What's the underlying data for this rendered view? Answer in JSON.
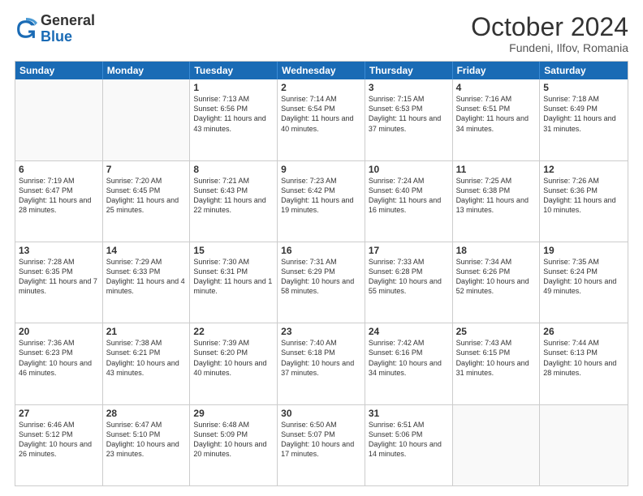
{
  "header": {
    "logo_general": "General",
    "logo_blue": "Blue",
    "month_year": "October 2024",
    "location": "Fundeni, Ilfov, Romania"
  },
  "weekdays": [
    "Sunday",
    "Monday",
    "Tuesday",
    "Wednesday",
    "Thursday",
    "Friday",
    "Saturday"
  ],
  "rows": [
    [
      {
        "day": "",
        "info": ""
      },
      {
        "day": "",
        "info": ""
      },
      {
        "day": "1",
        "info": "Sunrise: 7:13 AM\nSunset: 6:56 PM\nDaylight: 11 hours and 43 minutes."
      },
      {
        "day": "2",
        "info": "Sunrise: 7:14 AM\nSunset: 6:54 PM\nDaylight: 11 hours and 40 minutes."
      },
      {
        "day": "3",
        "info": "Sunrise: 7:15 AM\nSunset: 6:53 PM\nDaylight: 11 hours and 37 minutes."
      },
      {
        "day": "4",
        "info": "Sunrise: 7:16 AM\nSunset: 6:51 PM\nDaylight: 11 hours and 34 minutes."
      },
      {
        "day": "5",
        "info": "Sunrise: 7:18 AM\nSunset: 6:49 PM\nDaylight: 11 hours and 31 minutes."
      }
    ],
    [
      {
        "day": "6",
        "info": "Sunrise: 7:19 AM\nSunset: 6:47 PM\nDaylight: 11 hours and 28 minutes."
      },
      {
        "day": "7",
        "info": "Sunrise: 7:20 AM\nSunset: 6:45 PM\nDaylight: 11 hours and 25 minutes."
      },
      {
        "day": "8",
        "info": "Sunrise: 7:21 AM\nSunset: 6:43 PM\nDaylight: 11 hours and 22 minutes."
      },
      {
        "day": "9",
        "info": "Sunrise: 7:23 AM\nSunset: 6:42 PM\nDaylight: 11 hours and 19 minutes."
      },
      {
        "day": "10",
        "info": "Sunrise: 7:24 AM\nSunset: 6:40 PM\nDaylight: 11 hours and 16 minutes."
      },
      {
        "day": "11",
        "info": "Sunrise: 7:25 AM\nSunset: 6:38 PM\nDaylight: 11 hours and 13 minutes."
      },
      {
        "day": "12",
        "info": "Sunrise: 7:26 AM\nSunset: 6:36 PM\nDaylight: 11 hours and 10 minutes."
      }
    ],
    [
      {
        "day": "13",
        "info": "Sunrise: 7:28 AM\nSunset: 6:35 PM\nDaylight: 11 hours and 7 minutes."
      },
      {
        "day": "14",
        "info": "Sunrise: 7:29 AM\nSunset: 6:33 PM\nDaylight: 11 hours and 4 minutes."
      },
      {
        "day": "15",
        "info": "Sunrise: 7:30 AM\nSunset: 6:31 PM\nDaylight: 11 hours and 1 minute."
      },
      {
        "day": "16",
        "info": "Sunrise: 7:31 AM\nSunset: 6:29 PM\nDaylight: 10 hours and 58 minutes."
      },
      {
        "day": "17",
        "info": "Sunrise: 7:33 AM\nSunset: 6:28 PM\nDaylight: 10 hours and 55 minutes."
      },
      {
        "day": "18",
        "info": "Sunrise: 7:34 AM\nSunset: 6:26 PM\nDaylight: 10 hours and 52 minutes."
      },
      {
        "day": "19",
        "info": "Sunrise: 7:35 AM\nSunset: 6:24 PM\nDaylight: 10 hours and 49 minutes."
      }
    ],
    [
      {
        "day": "20",
        "info": "Sunrise: 7:36 AM\nSunset: 6:23 PM\nDaylight: 10 hours and 46 minutes."
      },
      {
        "day": "21",
        "info": "Sunrise: 7:38 AM\nSunset: 6:21 PM\nDaylight: 10 hours and 43 minutes."
      },
      {
        "day": "22",
        "info": "Sunrise: 7:39 AM\nSunset: 6:20 PM\nDaylight: 10 hours and 40 minutes."
      },
      {
        "day": "23",
        "info": "Sunrise: 7:40 AM\nSunset: 6:18 PM\nDaylight: 10 hours and 37 minutes."
      },
      {
        "day": "24",
        "info": "Sunrise: 7:42 AM\nSunset: 6:16 PM\nDaylight: 10 hours and 34 minutes."
      },
      {
        "day": "25",
        "info": "Sunrise: 7:43 AM\nSunset: 6:15 PM\nDaylight: 10 hours and 31 minutes."
      },
      {
        "day": "26",
        "info": "Sunrise: 7:44 AM\nSunset: 6:13 PM\nDaylight: 10 hours and 28 minutes."
      }
    ],
    [
      {
        "day": "27",
        "info": "Sunrise: 6:46 AM\nSunset: 5:12 PM\nDaylight: 10 hours and 26 minutes."
      },
      {
        "day": "28",
        "info": "Sunrise: 6:47 AM\nSunset: 5:10 PM\nDaylight: 10 hours and 23 minutes."
      },
      {
        "day": "29",
        "info": "Sunrise: 6:48 AM\nSunset: 5:09 PM\nDaylight: 10 hours and 20 minutes."
      },
      {
        "day": "30",
        "info": "Sunrise: 6:50 AM\nSunset: 5:07 PM\nDaylight: 10 hours and 17 minutes."
      },
      {
        "day": "31",
        "info": "Sunrise: 6:51 AM\nSunset: 5:06 PM\nDaylight: 10 hours and 14 minutes."
      },
      {
        "day": "",
        "info": ""
      },
      {
        "day": "",
        "info": ""
      }
    ]
  ]
}
